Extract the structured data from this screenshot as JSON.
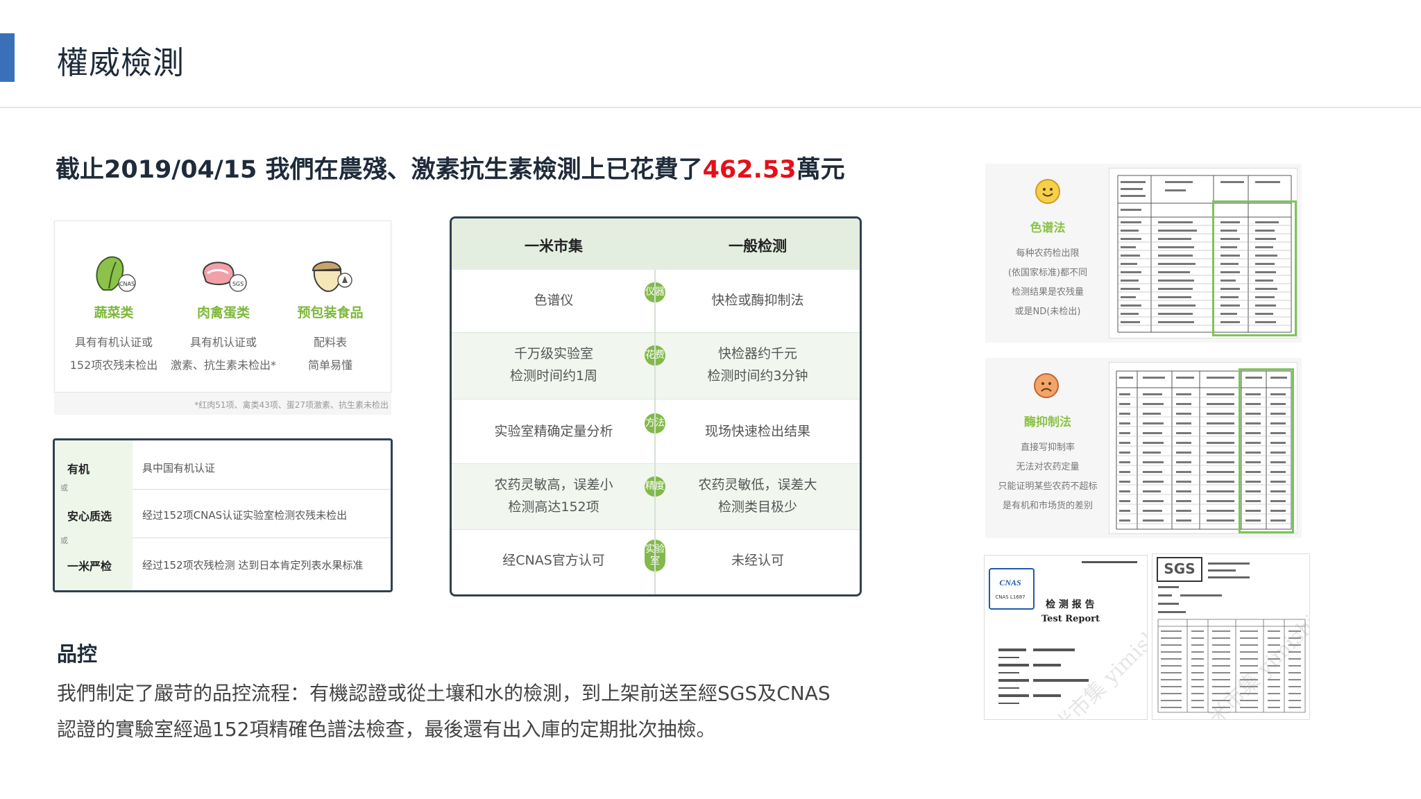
{
  "header": {
    "title": "權威檢測"
  },
  "headline": {
    "prefix": "截止2019/04/15 我們在農殘、激素抗生素檢測上已花費了",
    "amount": "462.53",
    "suffix": "萬元"
  },
  "categories": [
    {
      "name": "蔬菜类",
      "line1": "具有有机认证或",
      "line2": "152项农残未检出",
      "badge": "CNAS"
    },
    {
      "name": "肉禽蛋类",
      "line1": "具有机认证或",
      "line2": "激素、抗生素未检出*",
      "badge": "SGS"
    },
    {
      "name": "预包装食品",
      "line1": "配料表",
      "line2": "简单易懂",
      "badge": ""
    }
  ],
  "footnote": "*红肉51项、禽类43项、蛋27项激素、抗生素未检出",
  "grades": [
    {
      "label": "有机",
      "desc": "具中国有机认证"
    },
    {
      "label": "安心质选",
      "desc": "经过152项CNAS认证实验室检测农残未检出"
    },
    {
      "label": "一米严检",
      "desc": "经过152项农残检测 达到日本肯定列表水果标准"
    }
  ],
  "grade_or": "或",
  "comparison": {
    "col_left": "一米市集",
    "col_right": "一般检测",
    "rows": [
      {
        "tag": "仪器",
        "left1": "色谱仪",
        "left2": "",
        "right1": "快检或酶抑制法",
        "right2": ""
      },
      {
        "tag": "花费",
        "left1": "千万级实验室",
        "left2": "检测时间约1周",
        "right1": "快检器约千元",
        "right2": "检测时间约3分钟"
      },
      {
        "tag": "方法",
        "left1": "实验室精确定量分析",
        "left2": "",
        "right1": "现场快速检出结果",
        "right2": ""
      },
      {
        "tag": "精度",
        "left1": "农药灵敏高，误差小",
        "left2": "检测高达152项",
        "right1": "农药灵敏低，误差大",
        "right2": "检测类目极少"
      },
      {
        "tag": "实验室",
        "left1": "经CNAS官方认可",
        "left2": "",
        "right1": "未经认可",
        "right2": ""
      }
    ]
  },
  "quality": {
    "title": "品控",
    "line1": "我們制定了嚴苛的品控流程：有機認證或從土壤和水的檢測，到上架前送至經SGS及CNAS",
    "line2": "認證的實驗室經過152項精確色譜法檢查，最後還有出入庫的定期批次抽檢。"
  },
  "methods": [
    {
      "name": "色谱法",
      "d1": "每种农药检出限",
      "d2": "(依国家标准)都不同",
      "d3": "检测结果是农残量",
      "d4": "或是ND(未检出)"
    },
    {
      "name": "酶抑制法",
      "d1": "直接写抑制率",
      "d2": "无法对农药定量",
      "d3": "只能证明某些农药不超标",
      "d4": "是有机和市场货的差别"
    }
  ],
  "reports": {
    "cnas": "CNAS",
    "cnas_sub": "CNAS L1687",
    "report_cn": "检  测  报  告",
    "report_en": "Test   Report",
    "sgs": "SGS",
    "watermark": "米市集 yimishiji.com"
  },
  "colors": {
    "accent": "#3a70b8",
    "highlight": "#e3101a",
    "green": "#82b94a"
  }
}
